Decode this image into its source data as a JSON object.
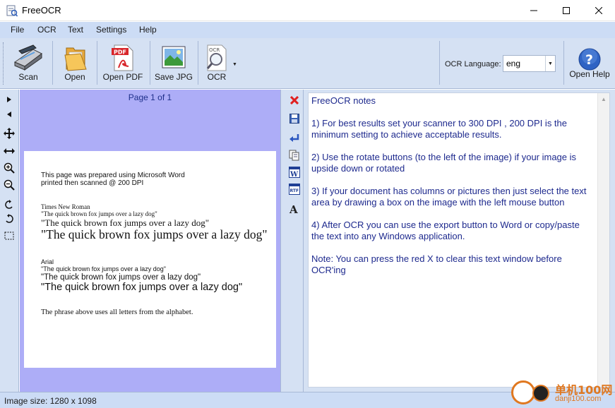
{
  "window": {
    "title": "FreeOCR",
    "minimize_icon": "minimize-icon",
    "maximize_icon": "maximize-icon",
    "close_icon": "close-icon"
  },
  "menu": {
    "items": [
      "File",
      "OCR",
      "Text",
      "Settings",
      "Help"
    ]
  },
  "toolbar": {
    "scan_label": "Scan",
    "open_label": "Open",
    "open_pdf_label": "Open PDF",
    "save_jpg_label": "Save JPG",
    "ocr_label": "OCR",
    "ocr_language_label": "OCR Language:",
    "ocr_language_value": "eng",
    "open_help_label": "Open Help"
  },
  "image_pane": {
    "page_indicator": "Page 1 of 1",
    "scanned_lines": {
      "intro1": "This page was prepared using Microsoft Word",
      "intro2": "printed then scanned @ 200 DPI",
      "tnr_heading": "Times New Roman",
      "tnr_small": "\"The quick brown fox jumps over a lazy dog\"",
      "tnr_medium": "\"The quick brown fox jumps over a lazy dog\"",
      "tnr_large": "\"The quick brown fox jumps over a lazy dog\"",
      "arial_heading": "Arial",
      "arial_small": "\"The quick brown fox jumps over a lazy dog\"",
      "arial_medium": "\"The quick brown fox  jumps over a lazy dog\"",
      "arial_large": "\"The quick brown fox jumps over a lazy dog\"",
      "footer": "The phrase above uses all letters from the alphabet."
    }
  },
  "text_pane": {
    "title": "FreeOCR notes",
    "paragraphs": [
      "1) For best results set your scanner to 300 DPI , 200 DPI is the minimum setting to achieve acceptable results.",
      "2) Use the rotate buttons (to the left of the image) if your image is upside down or rotated",
      "3) If your document has columns or pictures then just select the text area by drawing a box on the image with the left mouse button",
      "4) After OCR you can use the export button to Word or copy/paste the text into any Windows application.",
      "Note: You can press the red X to clear this text window before OCR'ing"
    ]
  },
  "status": {
    "text": "Image size:  1280 x  1098"
  },
  "watermark": {
    "title": "单机100网",
    "url": "danji100.com"
  },
  "colors": {
    "menubar": "#ccdcf5",
    "toolbar": "#d5e1f3",
    "image_pane_bg": "#adadf7",
    "notes_text": "#1e2a8e",
    "clear_red": "#e02020"
  }
}
